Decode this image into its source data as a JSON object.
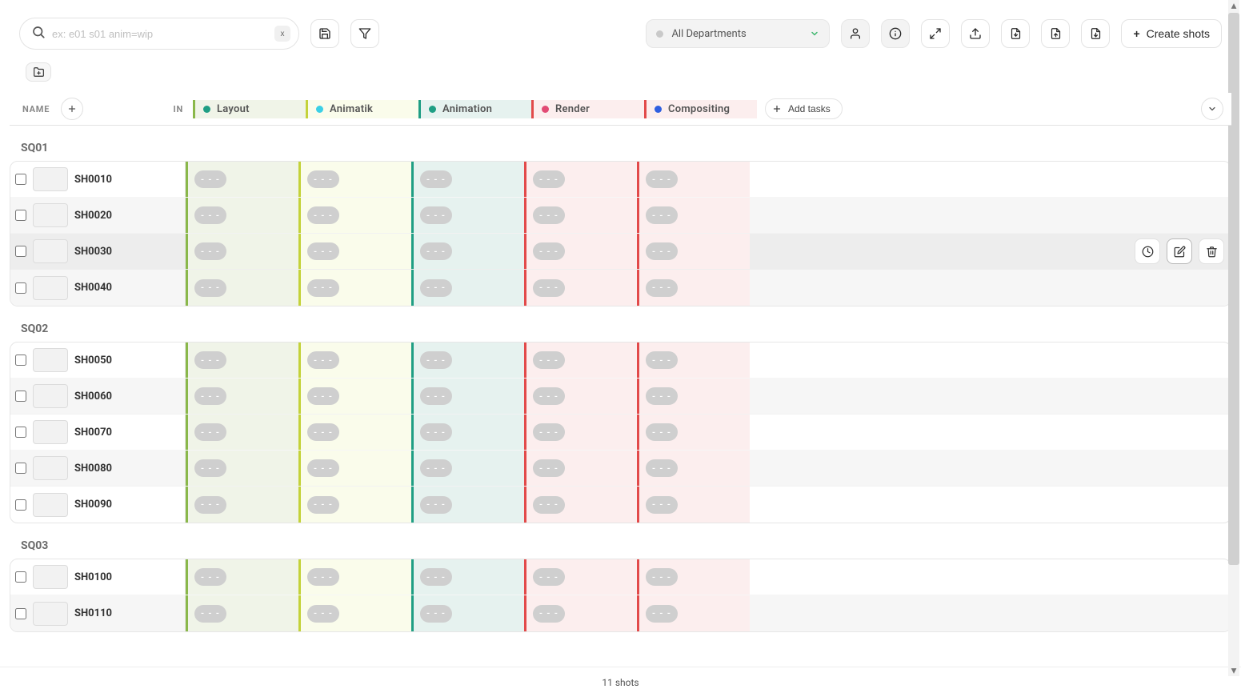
{
  "toolbar": {
    "search_placeholder": "ex: e01 s01 anim=wip",
    "search_value": "",
    "clear_label": "x",
    "department_label": "All Departments",
    "create_label": "Create shots",
    "add_tasks_label": "Add tasks"
  },
  "columns": {
    "name_header": "NAME",
    "in_header": "IN"
  },
  "task_types": [
    {
      "id": "layout",
      "label": "Layout",
      "dot": "#1f9e84",
      "border": "#8ab84a",
      "bg": "#f0f4e8"
    },
    {
      "id": "animatik",
      "label": "Animatik",
      "dot": "#3bd0e6",
      "border": "#c4d23a",
      "bg": "#fafceb"
    },
    {
      "id": "animation",
      "label": "Animation",
      "dot": "#1f9e84",
      "border": "#1f9e84",
      "bg": "#e6f2ef"
    },
    {
      "id": "render",
      "label": "Render",
      "dot": "#e24a74",
      "border": "#e24a4a",
      "bg": "#fceeee"
    },
    {
      "id": "compositing",
      "label": "Compositing",
      "dot": "#2f5fe0",
      "border": "#e24a4a",
      "bg": "#fceeee"
    }
  ],
  "status_empty": "- - -",
  "sequences": [
    {
      "name": "SQ01",
      "shots": [
        {
          "name": "SH0010"
        },
        {
          "name": "SH0020"
        },
        {
          "name": "SH0030",
          "hovered": true
        },
        {
          "name": "SH0040"
        }
      ]
    },
    {
      "name": "SQ02",
      "shots": [
        {
          "name": "SH0050"
        },
        {
          "name": "SH0060"
        },
        {
          "name": "SH0070"
        },
        {
          "name": "SH0080"
        },
        {
          "name": "SH0090"
        }
      ]
    },
    {
      "name": "SQ03",
      "shots": [
        {
          "name": "SH0100"
        },
        {
          "name": "SH0110"
        }
      ]
    }
  ],
  "footer": {
    "count": 11,
    "unit": "shots"
  }
}
